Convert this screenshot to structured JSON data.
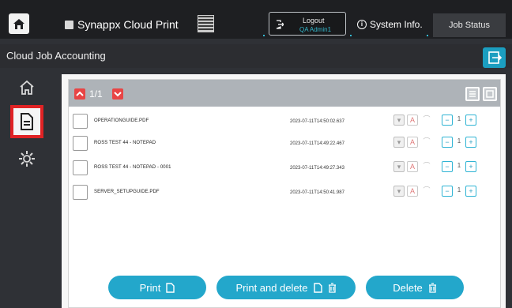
{
  "header": {
    "app_title": "Synappx Cloud Print",
    "logout_label": "Logout",
    "logout_user": "QA Admin1",
    "sysinfo_label": "System Info.",
    "job_status_label": "Job Status"
  },
  "page": {
    "title": "Cloud Job Accounting"
  },
  "nav": {
    "items": [
      {
        "name": "home",
        "icon": "home-icon"
      },
      {
        "name": "document",
        "icon": "document-icon",
        "selected": true
      },
      {
        "name": "settings",
        "icon": "gear-icon"
      }
    ]
  },
  "pager": {
    "text": "1/1"
  },
  "jobs": [
    {
      "name": "OPERATIONGUIDE.PDF",
      "time": "2023-07-11T14:50:02.637",
      "qty": "1"
    },
    {
      "name": "ROSS TEST 44 - NOTEPAD",
      "time": "2023-07-11T14:49:22.467",
      "qty": "1"
    },
    {
      "name": "ROSS TEST 44 - NOTEPAD - 0001",
      "time": "2023-07-11T14:49:27.343",
      "qty": "1"
    },
    {
      "name": "SERVER_SETUPGUIDE.PDF",
      "time": "2023-07-11T14:50:41.987",
      "qty": "1"
    }
  ],
  "actions": {
    "print_label": "Print",
    "print_delete_label": "Print and delete",
    "delete_label": "Delete"
  },
  "colors": {
    "accent": "#23a7cb",
    "highlight": "#e02224",
    "topbar": "#1e1f22"
  }
}
